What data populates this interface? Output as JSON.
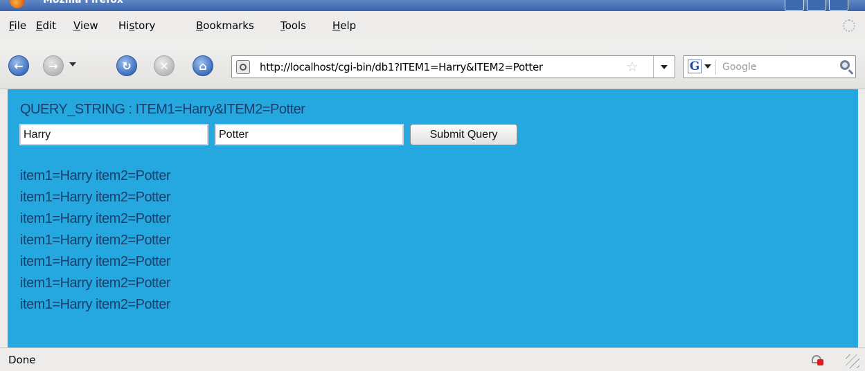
{
  "window": {
    "title": "Mozilla Firefox"
  },
  "menubar": {
    "items": [
      {
        "pre": "",
        "u": "F",
        "post": "ile"
      },
      {
        "pre": "",
        "u": "E",
        "post": "dit"
      },
      {
        "pre": "",
        "u": "V",
        "post": "iew"
      },
      {
        "pre": "Hi",
        "u": "s",
        "post": "tory"
      },
      {
        "pre": "",
        "u": "B",
        "post": "ookmarks"
      },
      {
        "pre": "",
        "u": "T",
        "post": "ools"
      },
      {
        "pre": "",
        "u": "H",
        "post": "elp"
      }
    ]
  },
  "navigation": {
    "url": "http://localhost/cgi-bin/db1?ITEM1=Harry&ITEM2=Potter",
    "search_engine_letter": "G",
    "search_placeholder": "Google"
  },
  "page": {
    "query_string_line": "QUERY_STRING : ITEM1=Harry&ITEM2=Potter",
    "item1_value": "Harry",
    "item2_value": "Potter",
    "submit_label": "Submit Query",
    "results": [
      "item1=Harry item2=Potter",
      "item1=Harry item2=Potter",
      "item1=Harry item2=Potter",
      "item1=Harry item2=Potter",
      "item1=Harry item2=Potter",
      "item1=Harry item2=Potter",
      "item1=Harry item2=Potter"
    ],
    "background_color": "#25a8df"
  },
  "statusbar": {
    "text": "Done"
  }
}
